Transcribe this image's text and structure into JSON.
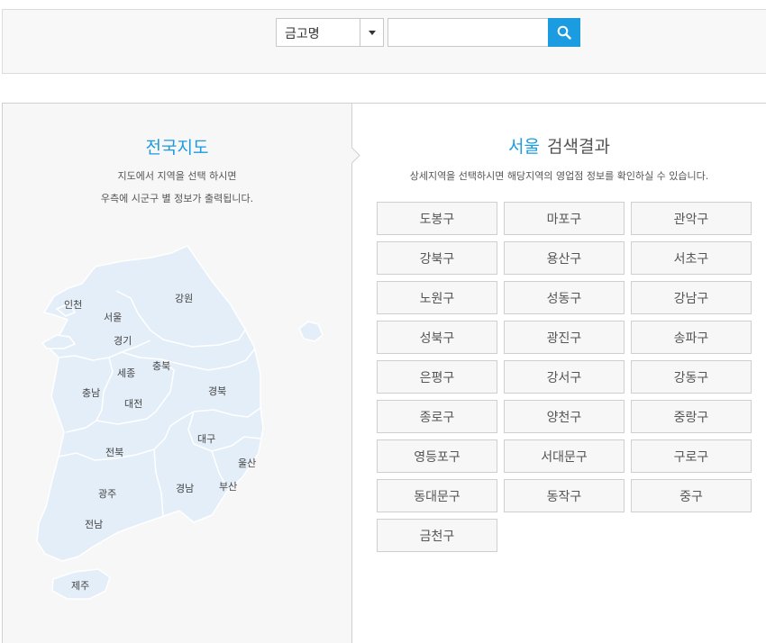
{
  "search": {
    "select_value": "금고명",
    "placeholder": ""
  },
  "map_panel": {
    "title": "전국지도",
    "desc_line1": "지도에서 지역을 선택 하시면",
    "desc_line2": "우측에 시군구 별 정보가 출력됩니다.",
    "regions": {
      "incheon": "인천",
      "seoul": "서울",
      "gangwon": "강원",
      "gyeonggi": "경기",
      "sejong": "세종",
      "chungbuk": "충북",
      "chungnam": "충남",
      "daejeon": "대전",
      "gyeongbuk": "경북",
      "daegu": "대구",
      "jeonbuk": "전북",
      "ulsan": "울산",
      "gwangju": "광주",
      "gyeongnam": "경남",
      "busan": "부산",
      "jeonnam": "전남",
      "jeju": "제주"
    }
  },
  "results": {
    "city": "서울",
    "suffix": "검색결과",
    "desc": "상세지역을 선택하시면 해당지역의 영업점 정보를 확인하실 수 있습니다.",
    "districts": [
      "도봉구",
      "마포구",
      "관악구",
      "강북구",
      "용산구",
      "서초구",
      "노원구",
      "성동구",
      "강남구",
      "성북구",
      "광진구",
      "송파구",
      "은평구",
      "강서구",
      "강동구",
      "종로구",
      "양천구",
      "중랑구",
      "영등포구",
      "서대문구",
      "구로구",
      "동대문구",
      "동작구",
      "중구",
      "금천구"
    ]
  },
  "colors": {
    "accent": "#1b9be0",
    "map_fill": "#e4eef8",
    "map_border": "#ffffff"
  }
}
